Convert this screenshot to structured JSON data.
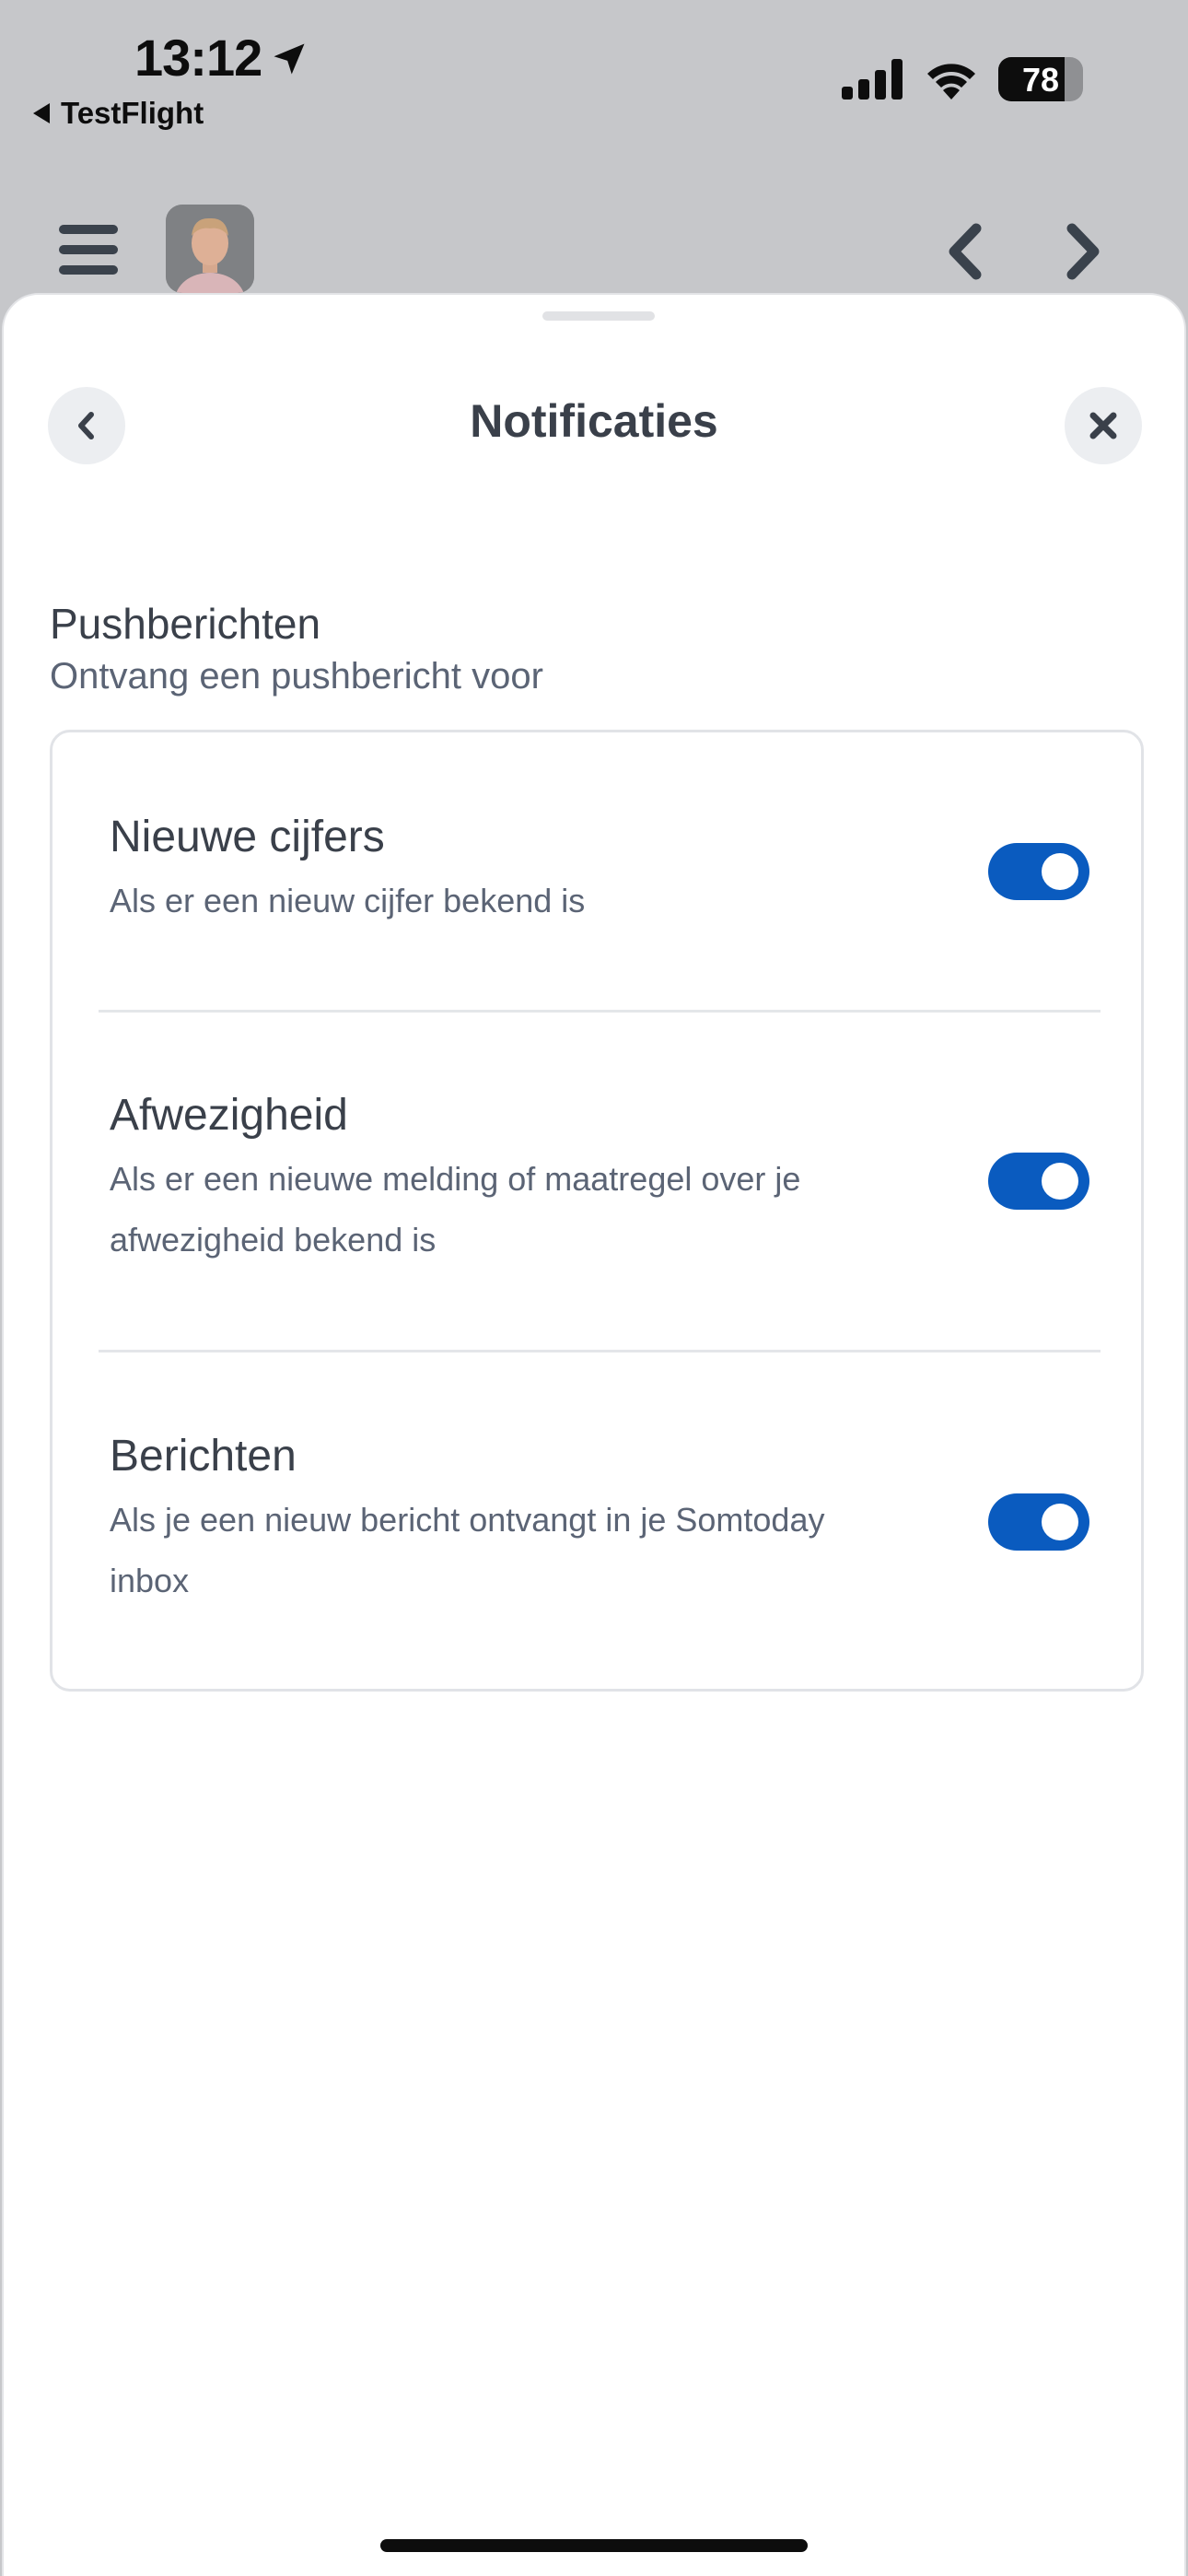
{
  "status_bar": {
    "time": "13:12",
    "back_app_label": "TestFlight",
    "battery_percent": "78",
    "battery_level": 0.78,
    "location_icon": "location-arrow-icon",
    "signal_icon": "cellular-signal-icon",
    "wifi_icon": "wifi-icon"
  },
  "app_header": {
    "menu_icon": "hamburger-menu-icon",
    "avatar": "user-avatar",
    "prev_icon": "chevron-left-icon",
    "next_icon": "chevron-right-icon"
  },
  "sheet": {
    "title": "Notificaties",
    "back_icon": "chevron-left-icon",
    "close_icon": "close-icon",
    "section": {
      "title": "Pushberichten",
      "subtitle": "Ontvang een pushbericht voor"
    },
    "items": [
      {
        "title": "Nieuwe cijfers",
        "description": "Als er een nieuw cijfer bekend is",
        "enabled": true
      },
      {
        "title": "Afwezigheid",
        "description": "Als er een nieuwe melding of maatregel over je afwezigheid bekend is",
        "enabled": true
      },
      {
        "title": "Berichten",
        "description": "Als je een nieuw bericht ontvangt in je Somtoday inbox",
        "enabled": true
      }
    ]
  },
  "colors": {
    "accent": "#0a5bbf",
    "text_primary": "#3a404a",
    "text_secondary": "#5b6475",
    "backdrop": "#c6c7ca"
  }
}
